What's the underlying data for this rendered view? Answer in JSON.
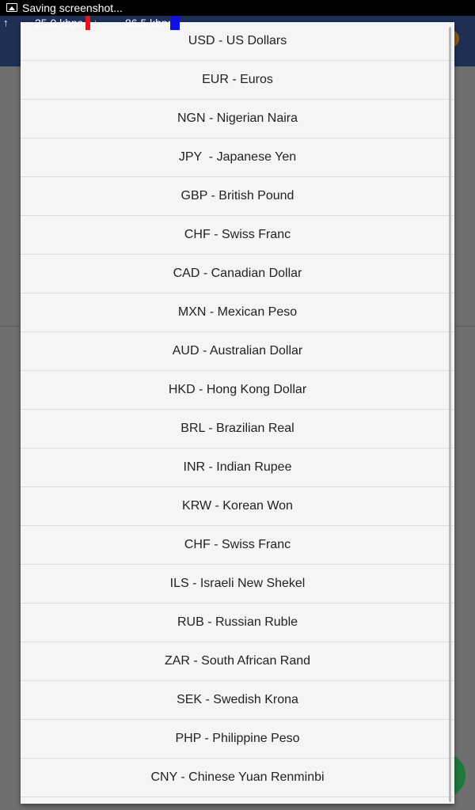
{
  "status_bar": {
    "notification_text": "Saving screenshot...",
    "notification_icon": "image-icon"
  },
  "speed_overlay": {
    "upload": "25.0 kbps",
    "download": "86.5 kbps",
    "upload_color": "#e8141c",
    "download_color": "#1010e0"
  },
  "colors": {
    "toolbar": "#1f2f56",
    "dropdown_bg": "#f5f5f5",
    "fab": "#1e7a3a"
  },
  "currency_options": [
    "USD - US Dollars",
    "EUR - Euros",
    "NGN - Nigerian Naira",
    "JPY  - Japanese Yen",
    "GBP - British Pound",
    "CHF - Swiss Franc",
    "CAD - Canadian Dollar",
    "MXN - Mexican Peso",
    "AUD - Australian Dollar",
    "HKD - Hong Kong Dollar",
    "BRL - Brazilian Real",
    "INR - Indian Rupee",
    "KRW - Korean Won",
    "CHF - Swiss Franc",
    "ILS - Israeli New Shekel",
    "RUB - Russian Ruble",
    "ZAR - South African Rand",
    "SEK - Swedish Krona",
    "PHP - Philippine Peso",
    "CNY - Chinese Yuan Renminbi"
  ]
}
